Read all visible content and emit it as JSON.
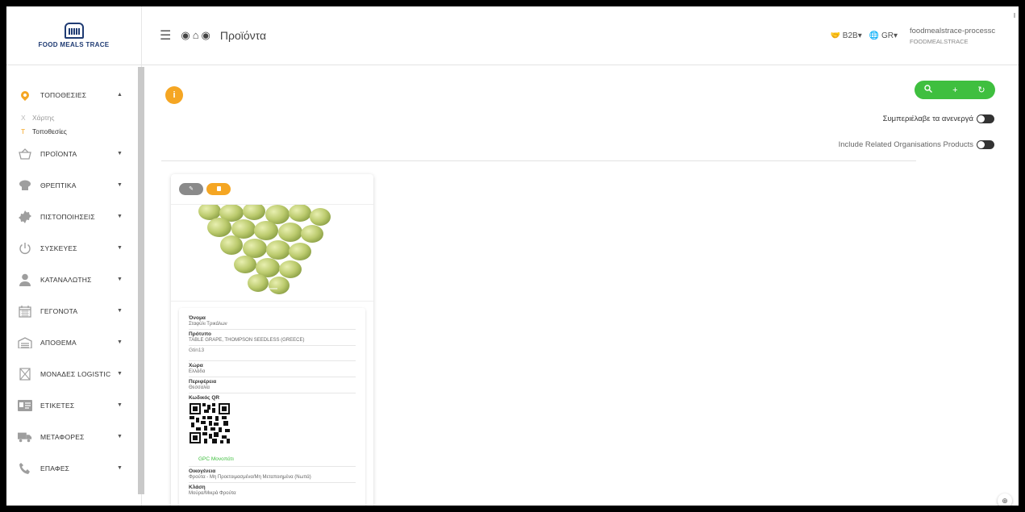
{
  "app": {
    "logo_text": "FOOD MEALS TRACE",
    "page_title": "Προϊόντα"
  },
  "topbar": {
    "b2b_label": "B2B",
    "lang_label": "GR",
    "username": "foodmealstrace-processc",
    "org": "FOODMEALSTRACE"
  },
  "sidebar": {
    "items": [
      {
        "label": "ΤΟΠΟΘΕΣΙΕΣ",
        "icon": "map-pin-icon",
        "expanded": true,
        "sub": [
          {
            "key": "X",
            "label": "Χάρτης"
          },
          {
            "key": "T",
            "label": "Τοποθεσίες"
          }
        ]
      },
      {
        "label": "ΠΡΟΪΟΝΤΑ",
        "icon": "basket-icon"
      },
      {
        "label": "ΘΡΕΠΤΙΚΑ",
        "icon": "chef-hat-icon"
      },
      {
        "label": "ΠΙΣΤΟΠΟΙΗΣΕΙΣ",
        "icon": "certificate-icon"
      },
      {
        "label": "ΣΥΣΚΕΥΕΣ",
        "icon": "power-icon"
      },
      {
        "label": "ΚΑΤΑΝΑΛΩΤΗΣ",
        "icon": "user-icon"
      },
      {
        "label": "ΓΕΓΟΝΟΤΑ",
        "icon": "calendar-icon"
      },
      {
        "label": "ΑΠΟΘΕΜΑ",
        "icon": "warehouse-icon"
      },
      {
        "label": "ΜΟΝΑΔΕΣ LOGISTIC",
        "icon": "box-icon"
      },
      {
        "label": "ΕΤΙΚΕΤΕΣ",
        "icon": "label-card-icon"
      },
      {
        "label": "ΜΕΤΑΦΟΡΕΣ",
        "icon": "truck-icon"
      },
      {
        "label": "ΕΠΑΦΕΣ",
        "icon": "phone-icon"
      }
    ]
  },
  "toolbar": {
    "include_inactive_label": "Συμπεριέλαβε τα ανενεργά",
    "include_related_label": "Include Related Organisations Products"
  },
  "product": {
    "fields": [
      {
        "label": "Όνομα",
        "value": "Σταφύλι Τρικάλων"
      },
      {
        "label": "Πρότυπο",
        "value": "TABLE GRAPE, THOMPSON SEEDLESS (GREECE)"
      },
      {
        "label": "Gtin13",
        "value": ""
      },
      {
        "label": "Χώρα",
        "value": "Ελλάδα"
      },
      {
        "label": "Περιφέρεια",
        "value": "Θεσσαλία"
      }
    ],
    "qr_label": "Κωδικός QR",
    "gpc_link": "GPC Μονοπάτι",
    "fields_after": [
      {
        "label": "Οικογένεια",
        "value": "Φρούτα - Μη Προετοιμασμένα/Μη Μεταποιημένα (Νωπά)"
      },
      {
        "label": "Κλάση",
        "value": "Μούρα/Μικρά Φρούτα"
      }
    ]
  },
  "colors": {
    "accent": "#f5a623",
    "success": "#3fbf3f",
    "brand": "#1f3b73"
  }
}
